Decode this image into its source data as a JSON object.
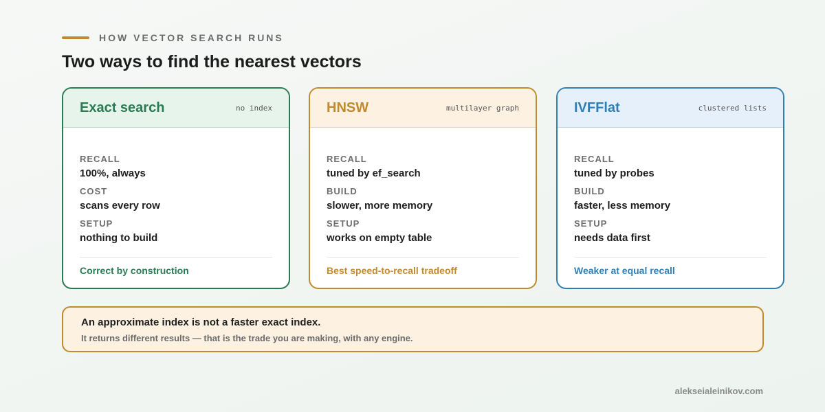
{
  "colors": {
    "accent": "#c08a2e",
    "green": "#2a7a52",
    "green_bg": "#e7f4ec",
    "orange": "#c08a2e",
    "orange_bg": "#fdf1e2",
    "blue": "#2f7fb5",
    "blue_bg": "#e6f0fa"
  },
  "header": {
    "eyebrow": "HOW VECTOR SEARCH RUNS",
    "title": "Two ways to find the nearest vectors"
  },
  "cards": [
    {
      "name": "Exact search",
      "tag": "no index",
      "rows": [
        {
          "label": "RECALL",
          "value": "100%, always"
        },
        {
          "label": "COST",
          "value": "scans every row"
        },
        {
          "label": "SETUP",
          "value": "nothing to build"
        }
      ],
      "footer": "Correct by construction"
    },
    {
      "name": "HNSW",
      "tag": "multilayer graph",
      "rows": [
        {
          "label": "RECALL",
          "value": "tuned by ef_search"
        },
        {
          "label": "BUILD",
          "value": "slower, more memory"
        },
        {
          "label": "SETUP",
          "value": "works on empty table"
        }
      ],
      "footer": "Best speed-to-recall tradeoff"
    },
    {
      "name": "IVFFlat",
      "tag": "clustered lists",
      "rows": [
        {
          "label": "RECALL",
          "value": "tuned by probes"
        },
        {
          "label": "BUILD",
          "value": "faster, less memory"
        },
        {
          "label": "SETUP",
          "value": "needs data first"
        }
      ],
      "footer": "Weaker at equal recall"
    }
  ],
  "note": {
    "title": "An approximate index is not a faster exact index.",
    "subtitle": "It returns different results — that is the trade you are making, with any engine."
  },
  "credit": "alekseialeinikov.com"
}
